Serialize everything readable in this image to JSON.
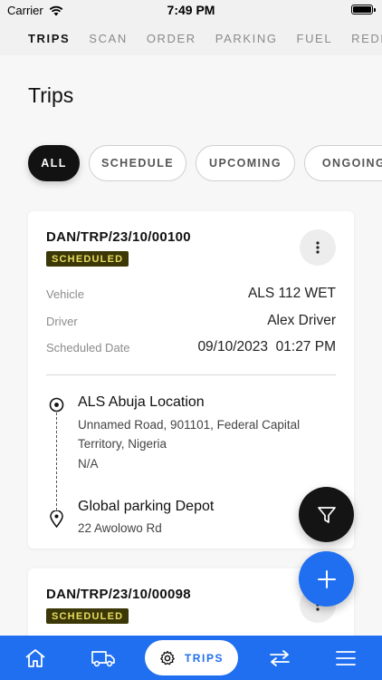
{
  "status_bar": {
    "carrier": "Carrier",
    "time": "7:49 PM"
  },
  "top_tabs": [
    {
      "label": "TRIPS",
      "active": true
    },
    {
      "label": "SCAN",
      "active": false
    },
    {
      "label": "ORDER",
      "active": false
    },
    {
      "label": "PARKING",
      "active": false
    },
    {
      "label": "FUEL",
      "active": false
    },
    {
      "label": "REDEE",
      "active": false
    }
  ],
  "page": {
    "title": "Trips"
  },
  "filters": [
    {
      "label": "ALL",
      "active": true
    },
    {
      "label": "SCHEDULE",
      "active": false
    },
    {
      "label": "UPCOMING",
      "active": false
    },
    {
      "label": "ONGOING",
      "active": false
    }
  ],
  "trips": [
    {
      "id": "DAN/TRP/23/10/00100",
      "status": "SCHEDULED",
      "vehicle_label": "Vehicle",
      "vehicle": "ALS 112 WET",
      "driver_label": "Driver",
      "driver": "Alex Driver",
      "date_label": "Scheduled Date",
      "date": "09/10/2023",
      "time": "01:27 PM",
      "origin": {
        "name": "ALS Abuja Location",
        "address_line1": "Unnamed Road, 901101, Federal Capital",
        "address_line2": "Territory, Nigeria",
        "note": "N/A"
      },
      "destination": {
        "name": "Global parking Depot",
        "address": "22 Awolowo Rd"
      }
    },
    {
      "id": "DAN/TRP/23/10/00098",
      "status": "SCHEDULED"
    }
  ],
  "bottom_nav": {
    "active_label": "TRIPS"
  },
  "colors": {
    "accent": "#1f6ff0",
    "badge_bg": "#3b3706",
    "badge_text": "#e8dc62",
    "dark": "#121212"
  }
}
